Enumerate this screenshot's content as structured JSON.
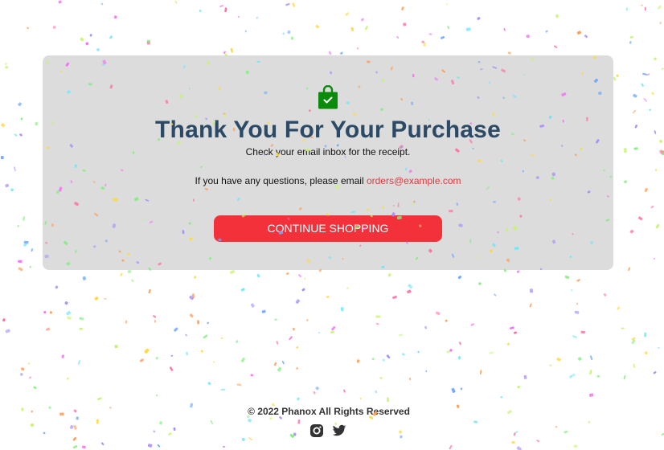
{
  "page": {
    "title": "Thank You For Your Purchase",
    "subtitle": "Check your email inbox for the receipt.",
    "contact_prefix": "If you have any questions, please email ",
    "contact_email": "orders@example.com",
    "cta_label": "Continue Shopping"
  },
  "footer": {
    "copyright": "© 2022 Phanox All Rights Reserved"
  },
  "icons": {
    "bag": "shopping-bag-check-icon",
    "instagram": "instagram-icon",
    "twitter": "twitter-icon"
  },
  "colors": {
    "card_background": "#dcdcdc",
    "title": "#2c4a66",
    "accent_red": "#f2313a",
    "email_link": "#e8353d",
    "bag_green": "#0b8a0b"
  }
}
